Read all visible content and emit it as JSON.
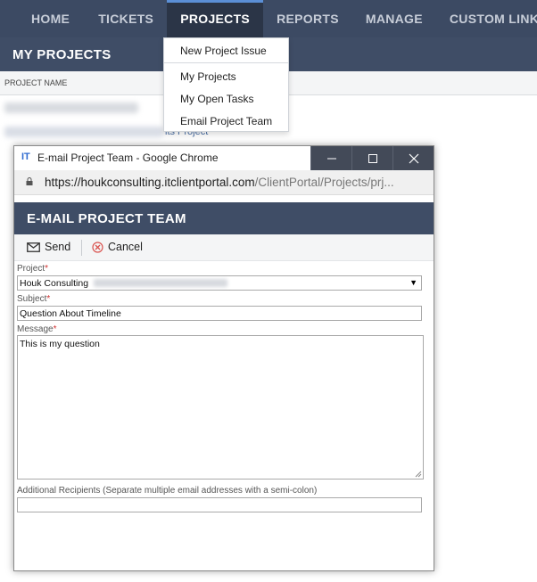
{
  "nav": {
    "items": [
      {
        "label": "HOME"
      },
      {
        "label": "TICKETS"
      },
      {
        "label": "PROJECTS"
      },
      {
        "label": "REPORTS"
      },
      {
        "label": "MANAGE"
      },
      {
        "label": "CUSTOM LINKS"
      }
    ],
    "active": "PROJECTS"
  },
  "page": {
    "title": "MY PROJECTS",
    "column_header": "PROJECT NAME",
    "partial_link": "its Project"
  },
  "dropdown": {
    "items": [
      {
        "label": "New Project Issue"
      },
      {
        "label": "My Projects"
      },
      {
        "label": "My Open Tasks"
      },
      {
        "label": "Email Project Team"
      }
    ]
  },
  "popup": {
    "app_icon": "IT",
    "window_title": "E-mail Project Team - Google Chrome",
    "window_buttons": {
      "minimize": "–",
      "maximize": "☐",
      "close": "✕"
    },
    "url_host": "https://houkconsulting.itclientportal.com",
    "url_path": "/ClientPortal/Projects/prj...",
    "header": "E-MAIL PROJECT TEAM",
    "toolbar": {
      "send_label": "Send",
      "cancel_label": "Cancel"
    },
    "form": {
      "project_label": "Project",
      "project_value": "Houk Consulting",
      "subject_label": "Subject",
      "subject_value": "Question About Timeline",
      "message_label": "Message",
      "message_value": "This is my question",
      "recipients_label": "Additional Recipients (Separate multiple email addresses with a semi-colon)",
      "recipients_value": "",
      "required_marker": "*"
    }
  },
  "colors": {
    "nav_bg": "#3c4a63",
    "nav_active_bg": "#2b3547",
    "header_bg": "#3f4d66",
    "window_button_bg": "#434a58",
    "required": "#d0302f"
  }
}
